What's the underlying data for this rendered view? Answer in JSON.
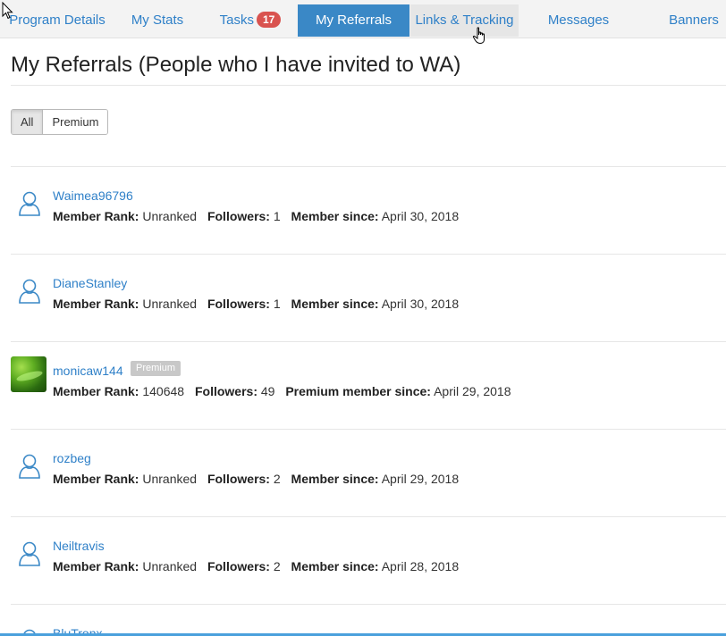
{
  "tabs": [
    {
      "label": "Program Details"
    },
    {
      "label": "My Stats"
    },
    {
      "label": "Tasks",
      "badge": "17"
    },
    {
      "label": "My Referrals",
      "active": true
    },
    {
      "label": "Links & Tracking"
    },
    {
      "label": "Messages"
    },
    {
      "label": "Banners"
    }
  ],
  "page_title": "My Referrals (People who I have invited to WA)",
  "filters": {
    "all": "All",
    "premium": "Premium"
  },
  "labels": {
    "rank": "Member Rank:",
    "followers": "Followers:",
    "since": "Member since:",
    "premium_since": "Premium member since:",
    "premium_badge": "Premium"
  },
  "referrals": [
    {
      "username": "Waimea96796",
      "rank": "Unranked",
      "followers": "1",
      "since": "April 30, 2018"
    },
    {
      "username": "DianeStanley",
      "rank": "Unranked",
      "followers": "1",
      "since": "April 30, 2018"
    },
    {
      "username": "monicaw144",
      "rank": "140648",
      "followers": "49",
      "since": "April 29, 2018",
      "premium": true
    },
    {
      "username": "rozbeg",
      "rank": "Unranked",
      "followers": "2",
      "since": "April 29, 2018"
    },
    {
      "username": "Neiltravis",
      "rank": "Unranked",
      "followers": "2",
      "since": "April 28, 2018"
    },
    {
      "username": "BluTronx"
    }
  ],
  "colors": {
    "accent": "#3a88c6",
    "link": "#2f80c8",
    "badge": "#d9534f"
  }
}
